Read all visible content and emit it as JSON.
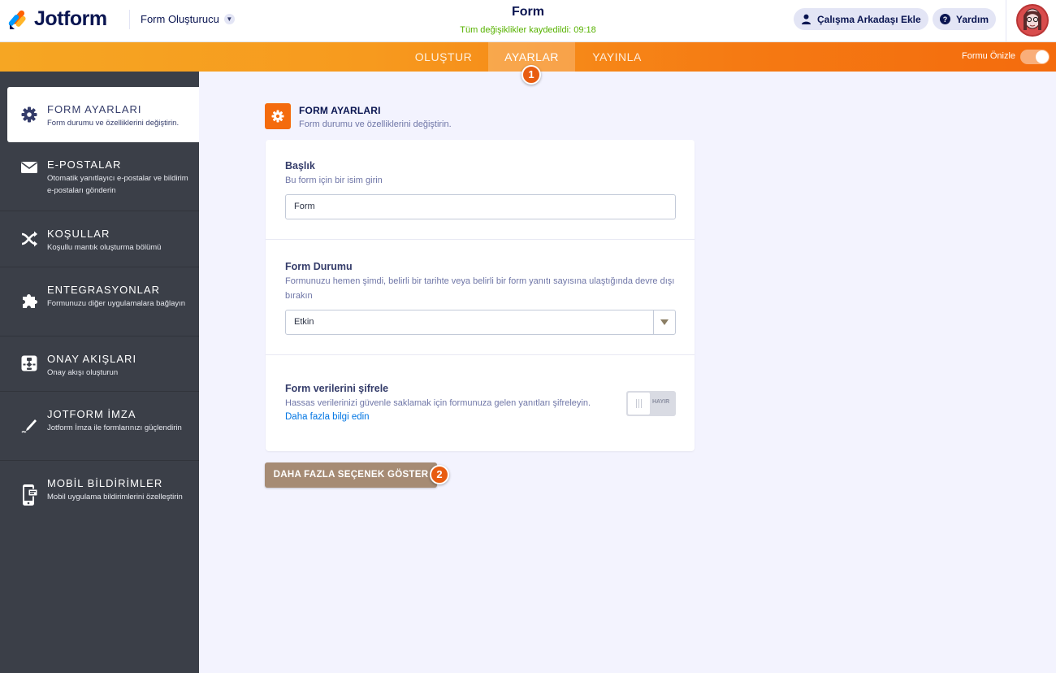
{
  "header": {
    "logo_text": "Jotform",
    "builder_label": "Form Oluşturucu",
    "form_title": "Form",
    "save_status": "Tüm değişiklikler kaydedildi: 09:18",
    "add_collaborator": "Çalışma Arkadaşı Ekle",
    "help": "Yardım"
  },
  "tabs": {
    "items": [
      {
        "label": "OLUŞTUR",
        "active": false
      },
      {
        "label": "AYARLAR",
        "active": true
      },
      {
        "label": "YAYINLA",
        "active": false
      }
    ],
    "preview_label": "Formu Önizle"
  },
  "annotations": {
    "step1": "1",
    "step2": "2"
  },
  "sidebar": {
    "items": [
      {
        "title": "FORM AYARLARI",
        "desc": "Form durumu ve özelliklerini değiştirin.",
        "icon": "gear-icon",
        "active": true
      },
      {
        "title": "E-POSTALAR",
        "desc": "Otomatik yanıtlayıcı e-postalar ve bildirim e-postaları gönderin",
        "icon": "envelope-icon",
        "active": false
      },
      {
        "title": "KOŞULLAR",
        "desc": "Koşullu mantık oluşturma bölümü",
        "icon": "shuffle-icon",
        "active": false
      },
      {
        "title": "ENTEGRASYONLAR",
        "desc": "Formunuzu diğer uygulamalara bağlayın",
        "icon": "puzzle-icon",
        "active": false
      },
      {
        "title": "ONAY AKIŞLARI",
        "desc": "Onay akışı oluşturun",
        "icon": "flow-icon",
        "active": false
      },
      {
        "title": "JOTFORM İMZA",
        "desc": "Jotform İmza ile formlarınızı güçlendirin",
        "icon": "signature-icon",
        "active": false
      },
      {
        "title": "MOBİL BİLDİRİMLER",
        "desc": "Mobil uygulama bildirimlerini özelleştirin",
        "icon": "mobile-icon",
        "active": false
      }
    ]
  },
  "main": {
    "section_title": "FORM AYARLARI",
    "section_desc": "Form durumu ve özelliklerini değiştirin.",
    "title_field": {
      "label": "Başlık",
      "desc": "Bu form için bir isim girin",
      "value": "Form"
    },
    "status_field": {
      "label": "Form Durumu",
      "desc": "Formunuzu hemen şimdi, belirli bir tarihte veya belirli bir form yanıtı sayısına ulaştığında devre dışı bırakın",
      "value": "Etkin"
    },
    "encrypt_field": {
      "label": "Form verilerini şifrele",
      "desc": "Hassas verilerinizi güvenle saklamak için formunuza gelen yanıtları şifreleyin.",
      "link": "Daha fazla bilgi edin",
      "toggle_label": "HAYIR"
    },
    "more_button": "DAHA FAZLA SEÇENEK GÖSTER"
  },
  "colors": {
    "accent_orange": "#f46b0d",
    "sidebar_bg": "#3b3f48",
    "save_green": "#57b200",
    "more_button_bg": "#a68b74",
    "link_blue": "#0075e3"
  }
}
